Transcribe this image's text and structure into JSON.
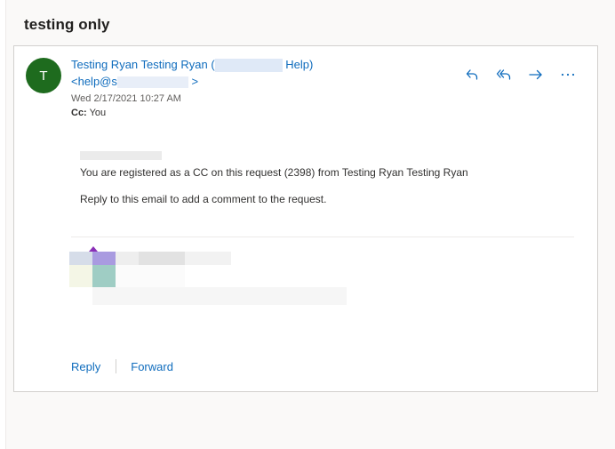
{
  "subject": "testing only",
  "sender": {
    "avatar_initial": "T",
    "name": "Testing Ryan Testing Ryan",
    "paren_open": "(",
    "help_suffix": "Help)",
    "address_prefix": "<help@s",
    "address_suffix": ">",
    "date": "Wed 2/17/2021 10:27 AM",
    "cc_label": "Cc:",
    "cc_value": "You"
  },
  "message": {
    "line1": "You are registered as a CC on this request (2398) from Testing Ryan Testing Ryan",
    "line2": "Reply to this email to add a comment to the request."
  },
  "footer": {
    "reply_label": "Reply",
    "forward_label": "Forward"
  },
  "icons": {
    "reply": "reply-icon",
    "reply_all": "reply-all-icon",
    "forward": "forward-icon",
    "more": "more-icon"
  },
  "colors": {
    "accent": "#0f6cbd",
    "avatar_bg": "#1e6b1e"
  }
}
